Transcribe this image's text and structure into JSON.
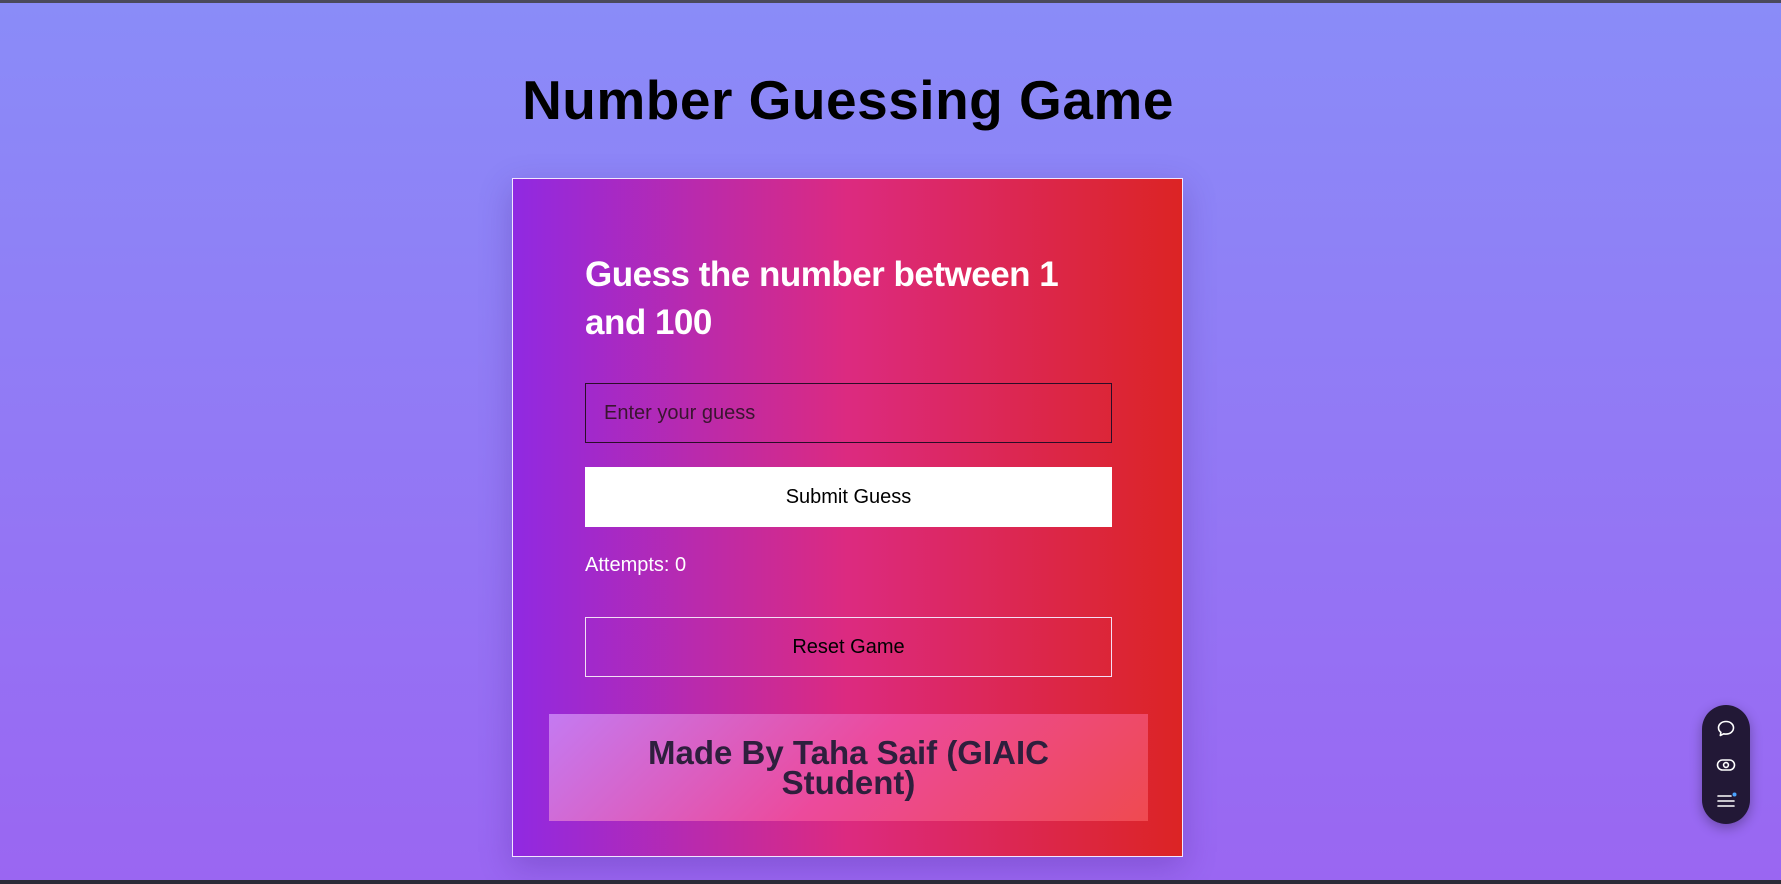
{
  "page": {
    "title": "Number Guessing Game"
  },
  "card": {
    "heading": "Guess the number between 1 and 100",
    "input_placeholder": "Enter your guess",
    "submit_label": "Submit Guess",
    "attempts_label": "Attempts:",
    "attempts_value": "0",
    "reset_label": "Reset Game",
    "footer_text": "Made By Taha Saif (GIAIC Student)"
  },
  "toolbar": {
    "icons": [
      "chat-bubble-icon",
      "eye-icon",
      "menu-list-icon"
    ],
    "badge_color": "#4aa3ff"
  },
  "colors": {
    "background_top": "#8a8cf8",
    "background_bottom": "#9a66f2",
    "card_gradient": [
      "#9029e2",
      "#dc2a80",
      "#dc2424"
    ],
    "banner_gradient": [
      "#c47af2",
      "#ec4a9c",
      "#ef4a50"
    ],
    "toolbar_bg": "#221836"
  }
}
